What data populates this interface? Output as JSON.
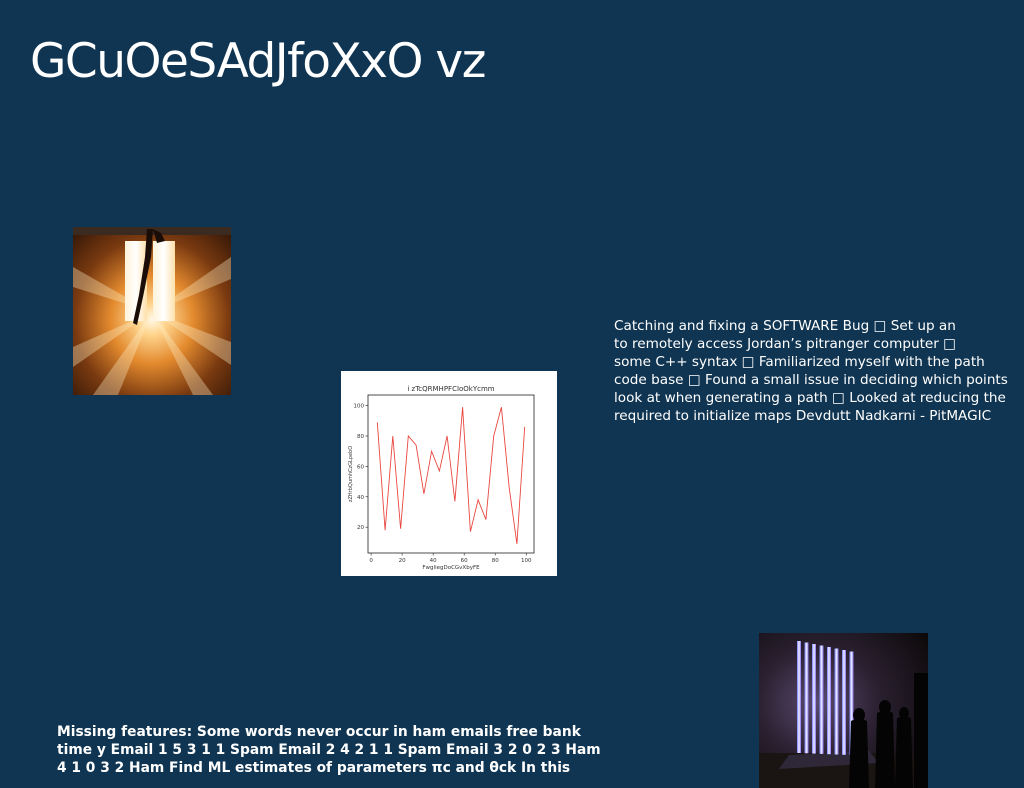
{
  "title": "GCuOeSAdJfoXxO vz",
  "right_text": "Catching and fixing a SOFTWARE Bug □ Set up an\nto remotely access Jordan’s pitranger computer □\nsome C++ syntax □ Familiarized myself with the path\ncode base □ Found a small issue in deciding which points\nlook at when generating a path □ Looked at reducing the\nrequired to initialize maps Devdutt Nadkarni - PitMAGIC",
  "bottom_text": "Missing features: Some words never occur in ham emails free bank\ntime y Email 1 5 3 1 1 Spam Email 2 4 2 1 1 Spam Email 3 2 0 2 3 Ham\n4 1 0 3 2 Ham Find ML estimates of parameters πc and θck In this",
  "images": {
    "left_photo": "glowing-light-photo",
    "right_photo": "light-tubes-installation-photo"
  },
  "colors": {
    "background": "#103552",
    "text": "#ffffff",
    "line": "#e8473f"
  },
  "chart_data": {
    "type": "line",
    "title": "i zTcQRMHPFCIoOkYcmm",
    "xlabel": "FwgliegDoCGvXbyFE",
    "ylabel": "zZHrbQumhCzGLpebO",
    "xlim": [
      -2,
      105
    ],
    "ylim": [
      3,
      107
    ],
    "xticks": [
      "0",
      "20",
      "40",
      "60",
      "80",
      "100"
    ],
    "yticks": [
      "20",
      "40",
      "60",
      "80",
      "100"
    ],
    "grid": false,
    "series": [
      {
        "x": [
          4,
          9,
          14,
          19,
          24,
          29,
          34,
          39,
          44,
          49,
          54,
          59,
          64,
          69,
          74,
          79,
          84,
          89,
          94,
          99
        ],
        "y": [
          89,
          18,
          80,
          19,
          80,
          74,
          42,
          70,
          57,
          80,
          37,
          99,
          17,
          38,
          25,
          80,
          99,
          46,
          9,
          86
        ]
      }
    ]
  }
}
